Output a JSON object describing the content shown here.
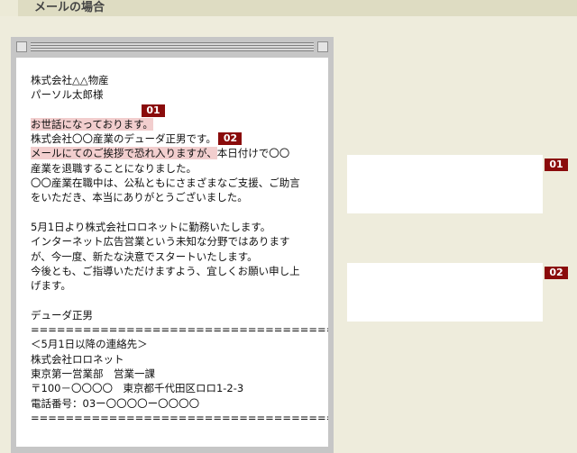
{
  "header": {
    "title": "メールの場合"
  },
  "mail": {
    "lines": [
      "株式会社△△物産",
      "パーソル太郎様",
      "",
      "",
      "",
      "",
      "産業を退職することになりました。",
      "〇〇産業在職中は、公私ともにさまざまなご支援、ご助言",
      "をいただき、本当にありがとうございました。",
      "",
      "5月1日より株式会社ロロネットに勤務いたします。",
      "インターネット広告営業という未知な分野ではあります",
      "が、今一度、新たな決意でスタートいたします。",
      "今後とも、ご指導いただけますよう、宜しくお願い申し上",
      "げます。",
      "",
      "デューダ正男",
      "====================================",
      "＜5月1日以降の連絡先＞",
      "株式会社ロロネット",
      "東京第一営業部　営業一課",
      "〒100－〇〇〇〇　東京都千代田区ロロ1-2-3",
      "電話番号：03ー〇〇〇〇ー〇〇〇〇",
      "===================================="
    ],
    "highlight1": "お世話になっております。",
    "line_company": "株式会社〇〇産業のデューダ正男です。",
    "highlight2": "メールにてのご挨拶で恐れ入りますが、",
    "line_after_highlight2": "本日付けで〇〇"
  },
  "badges": {
    "b1": "01",
    "b2": "02"
  },
  "notes": [
    {
      "badge": "01",
      "text": ""
    },
    {
      "badge": "02",
      "text": ""
    }
  ]
}
